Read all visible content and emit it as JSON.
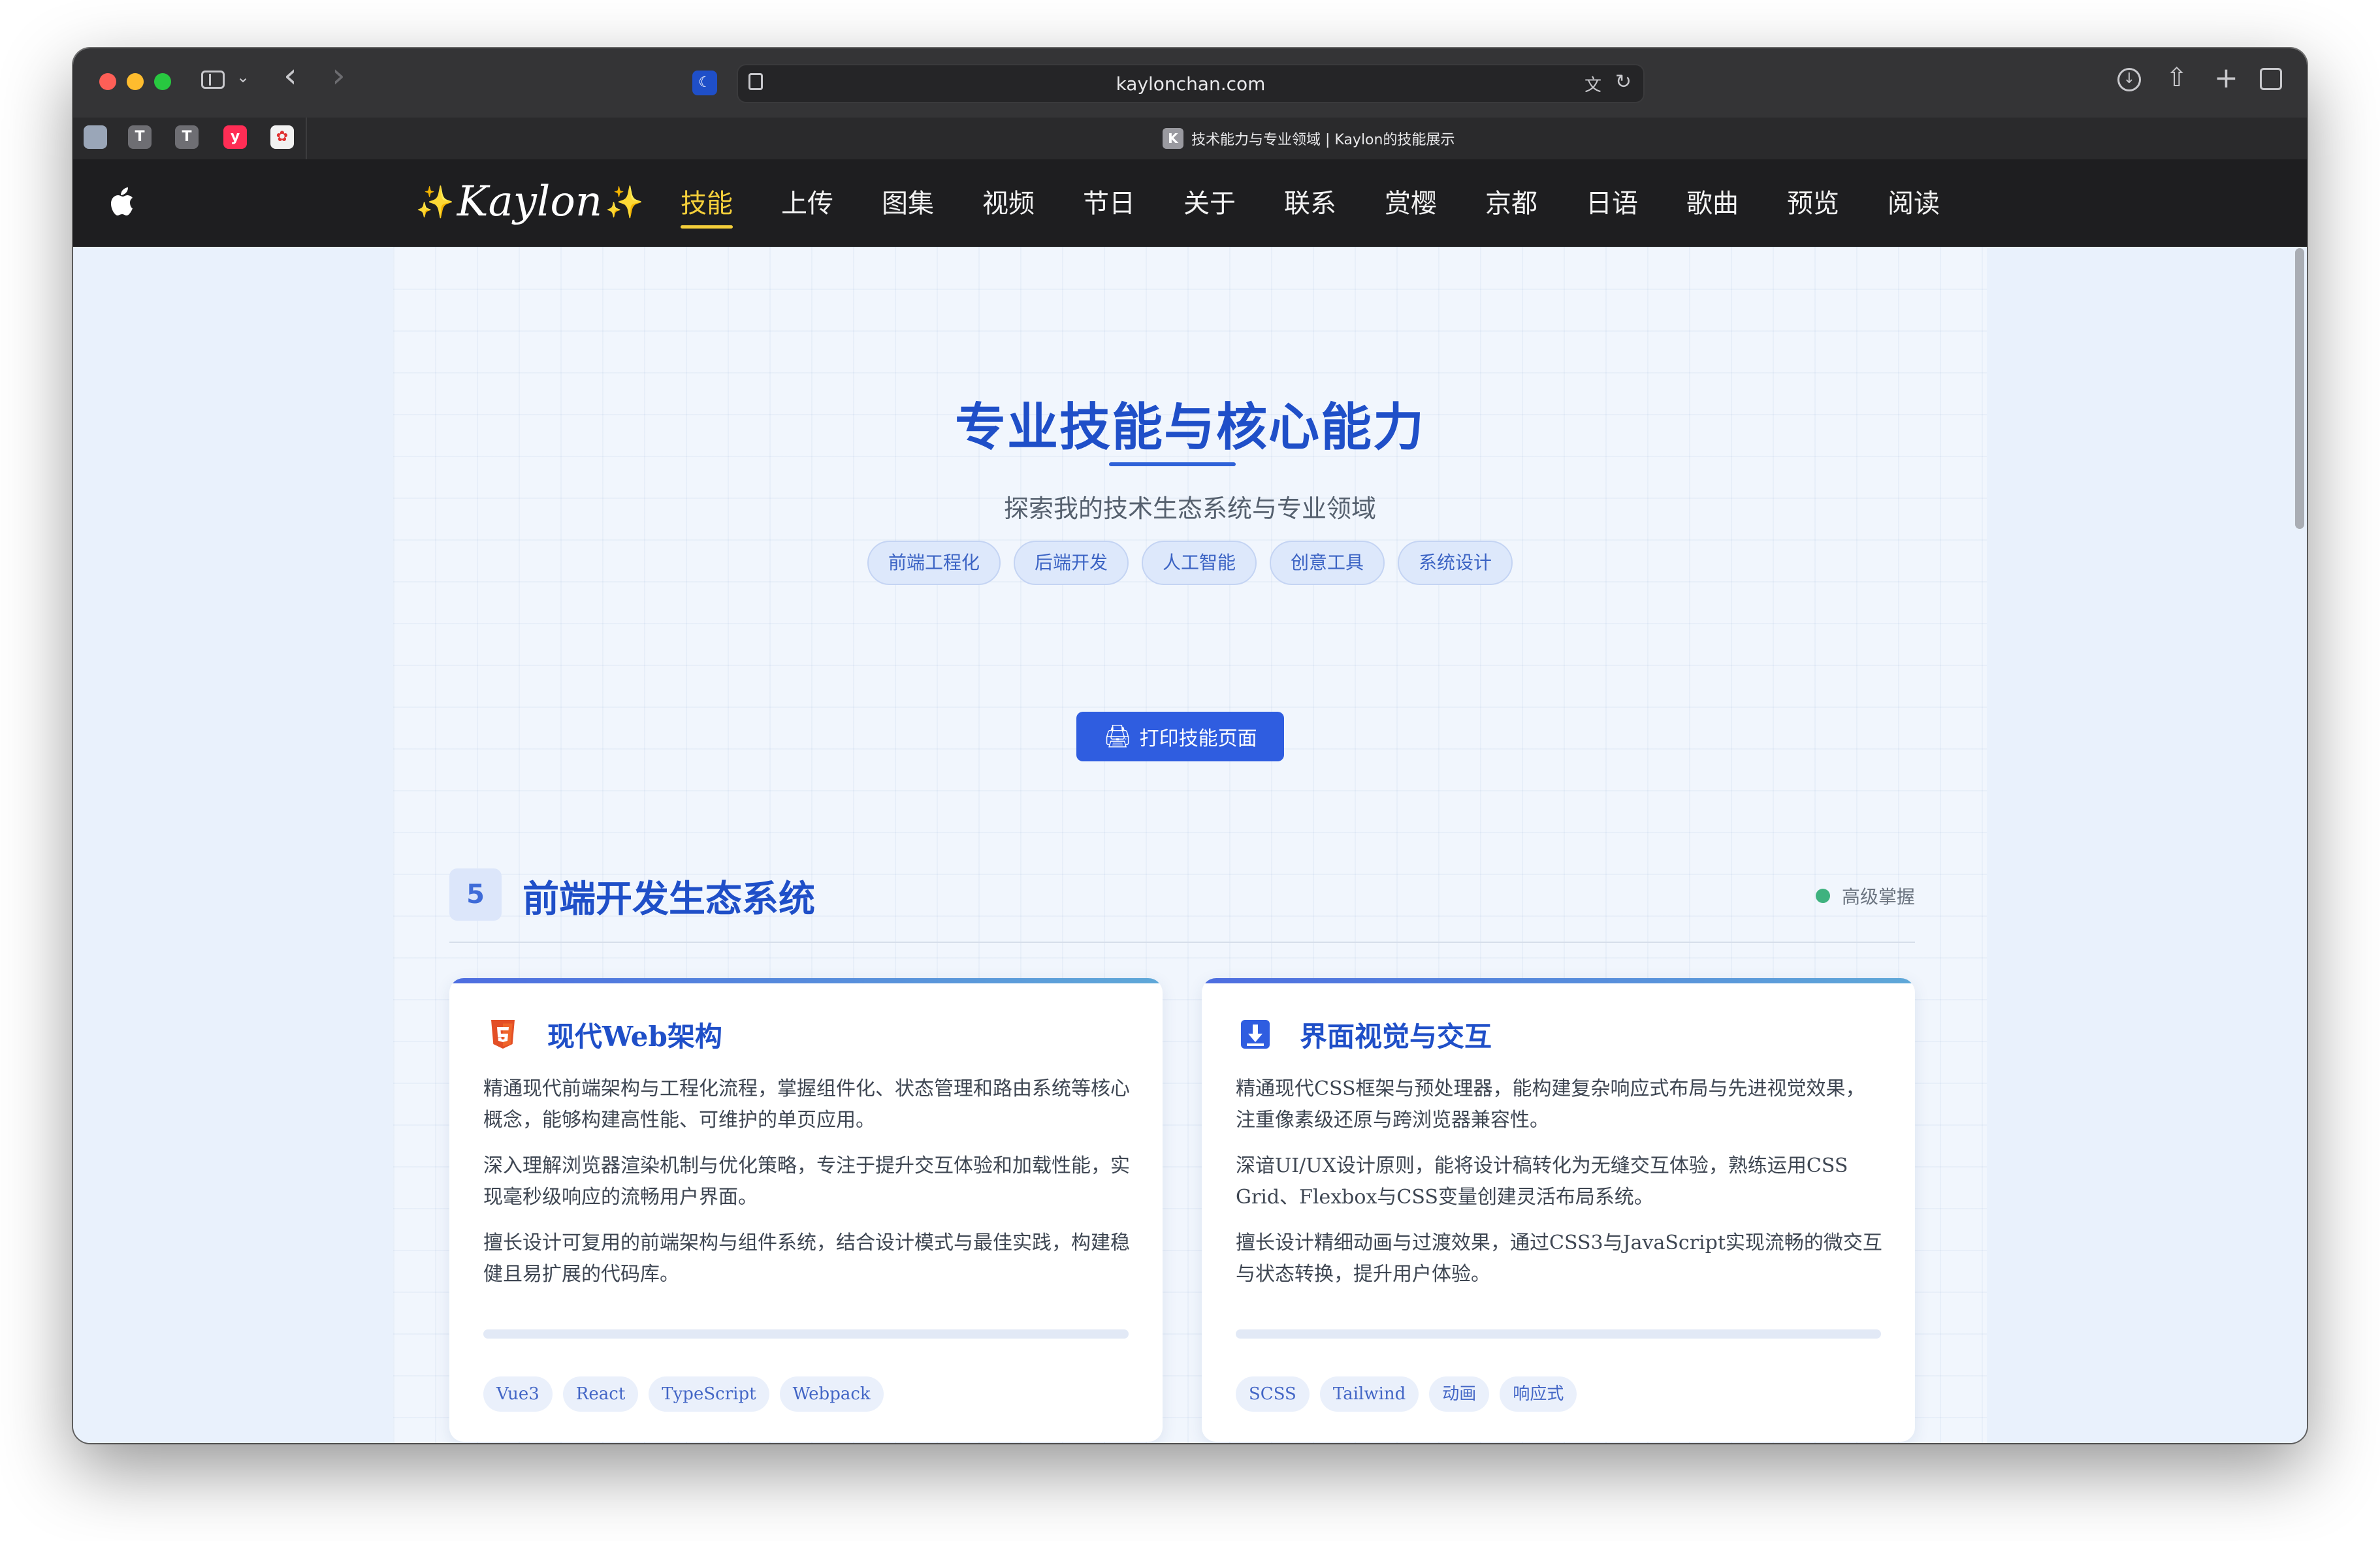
{
  "browser": {
    "url": "kaylonchan.com",
    "active_tab_title": "技术能力与专业领域 | Kaylon的技能展示",
    "active_tab_favicon": "K",
    "pinned_tabs": [
      "",
      "T",
      "T",
      "y",
      ""
    ]
  },
  "nav": {
    "logo": "Kaylon",
    "logo_sparkle": "✨",
    "links": [
      "技能",
      "上传",
      "图集",
      "视频",
      "节日",
      "关于",
      "联系",
      "赏樱",
      "京都",
      "日语",
      "歌曲",
      "预览",
      "阅读"
    ],
    "active_index": 0
  },
  "hero": {
    "title": "专业技能与核心能力",
    "subtitle": "探索我的技术生态系统与专业领域",
    "pills": [
      "前端工程化",
      "后端开发",
      "人工智能",
      "创意工具",
      "系统设计"
    ],
    "print_button": "打印技能页面",
    "print_icon": "🖨"
  },
  "section": {
    "badge": "5",
    "title": "前端开发生态系统",
    "level": "高级掌握",
    "level_color": "#3fb27f"
  },
  "cards": [
    {
      "icon": "html5-icon",
      "title": "现代Web架构",
      "paragraphs": [
        "精通现代前端架构与工程化流程，掌握组件化、状态管理和路由系统等核心概念，能够构建高性能、可维护的单页应用。",
        "深入理解浏览器渲染机制与优化策略，专注于提升交互体验和加载性能，实现毫秒级响应的流畅用户界面。",
        "擅长设计可复用的前端架构与组件系统，结合设计模式与最佳实践，构建稳健且易扩展的代码库。"
      ],
      "tags": [
        "Vue3",
        "React",
        "TypeScript",
        "Webpack"
      ]
    },
    {
      "icon": "download-box-icon",
      "title": "界面视觉与交互",
      "paragraphs": [
        "精通现代CSS框架与预处理器，能构建复杂响应式布局与先进视觉效果，注重像素级还原与跨浏览器兼容性。",
        "深谙UI/UX设计原则，能将设计稿转化为无缝交互体验，熟练运用CSS Grid、Flexbox与CSS变量创建灵活布局系统。",
        "擅长设计精细动画与过渡效果，通过CSS3与JavaScript实现流畅的微交互与状态转换，提升用户体验。"
      ],
      "tags": [
        "SCSS",
        "Tailwind",
        "动画",
        "响应式"
      ]
    }
  ],
  "colors": {
    "accent": "#1f4fc8",
    "nav_active": "#f5cf3a",
    "button": "#2f5de0"
  }
}
